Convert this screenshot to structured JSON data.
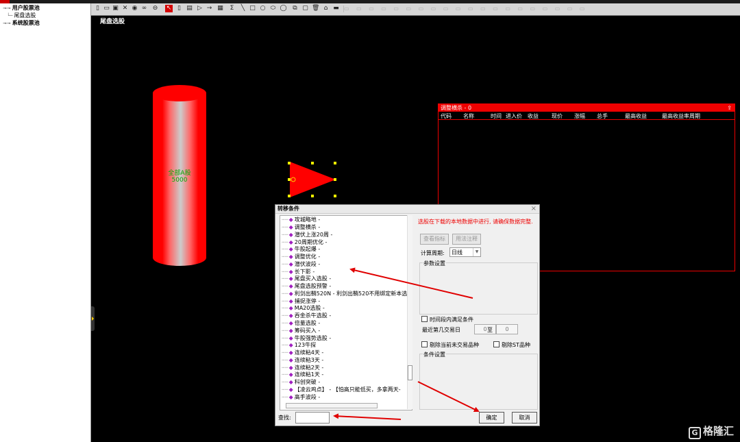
{
  "tree": {
    "items": [
      {
        "label": "用户股票池",
        "bold": true,
        "prefix": "⊸⊸"
      },
      {
        "label": "尾盘选股",
        "bold": false,
        "prefix": "└─"
      },
      {
        "label": "系统股票池",
        "bold": true,
        "prefix": "⊸⊸"
      }
    ]
  },
  "toolbar": {
    "icons": [
      "file-icon",
      "open-icon",
      "save-icon",
      "delete-icon",
      "play-icon",
      "link-icon",
      "minus-icon",
      "pointer-icon",
      "rect-icon",
      "calc-icon",
      "play-small-icon",
      "arrow-right-icon",
      "table-icon",
      "formula-icon",
      "line-icon",
      "square-icon",
      "circle-icon",
      "ellipse-icon",
      "oval-icon",
      "copy-icon",
      "paste-icon",
      "trash-icon",
      "lock-icon",
      "dash-icon"
    ]
  },
  "canvas": {
    "title": "尾盘选股",
    "cylinder_label_line1": "全部A股",
    "cylinder_label_line2": "5000"
  },
  "panel": {
    "title": "调整横杀 - 0",
    "columns": [
      "代码",
      "名称",
      "时间",
      "进入价",
      "收益",
      "现价",
      "涨幅",
      "总手",
      "最高收益",
      "最高收益率周期"
    ]
  },
  "dialog": {
    "title": "转移条件",
    "close": "×",
    "list_items": [
      "攻城略地 -",
      "调整横杀 -",
      "潜伏上涨20周 -",
      "20周期优化 -",
      "牛股起爆 -",
      "调整优化 -",
      "潜伏波段 -",
      "长下影 -",
      "尾盘买入选股 -",
      "尾盘选股预警 -",
      "利剑出鞘520N - 利剑出鞘520不用绑定新本选",
      "捕捉涨停 -",
      "MA20选股 -",
      "吞金杀牛选股 -",
      "倍量选股 -",
      "筹码买入 -",
      "牛股强势选股 -",
      "123牛探",
      "连续粘4天 -",
      "连续粘3天 -",
      "连续粘2天 -",
      "连续粘1天 -",
      "科创突破 -",
      "【凌云鸡点】 - 【怕高只能低买，多拿两天-",
      "高手波段 -"
    ],
    "notice": "选股在下载的本地数据中进行, 请确保数据完整.",
    "view_indicator": "查看指标",
    "usage_notes": "用法注释",
    "period_label": "计算周期:",
    "period_value": "日线",
    "param_group": "参数设置",
    "time_condition": "时间段内满足条件",
    "recent_days_label": "最近第几交易日",
    "day_from": "0",
    "to_label": "至",
    "day_to": "0",
    "exclude_untraded": "剔除当前未交易品种",
    "exclude_st": "剔除ST品种",
    "condition_group": "条件设置",
    "search_label": "查找:",
    "search_value": "",
    "ok": "确定",
    "cancel": "取消"
  },
  "watermark": {
    "icon": "G",
    "text": "格隆汇"
  }
}
